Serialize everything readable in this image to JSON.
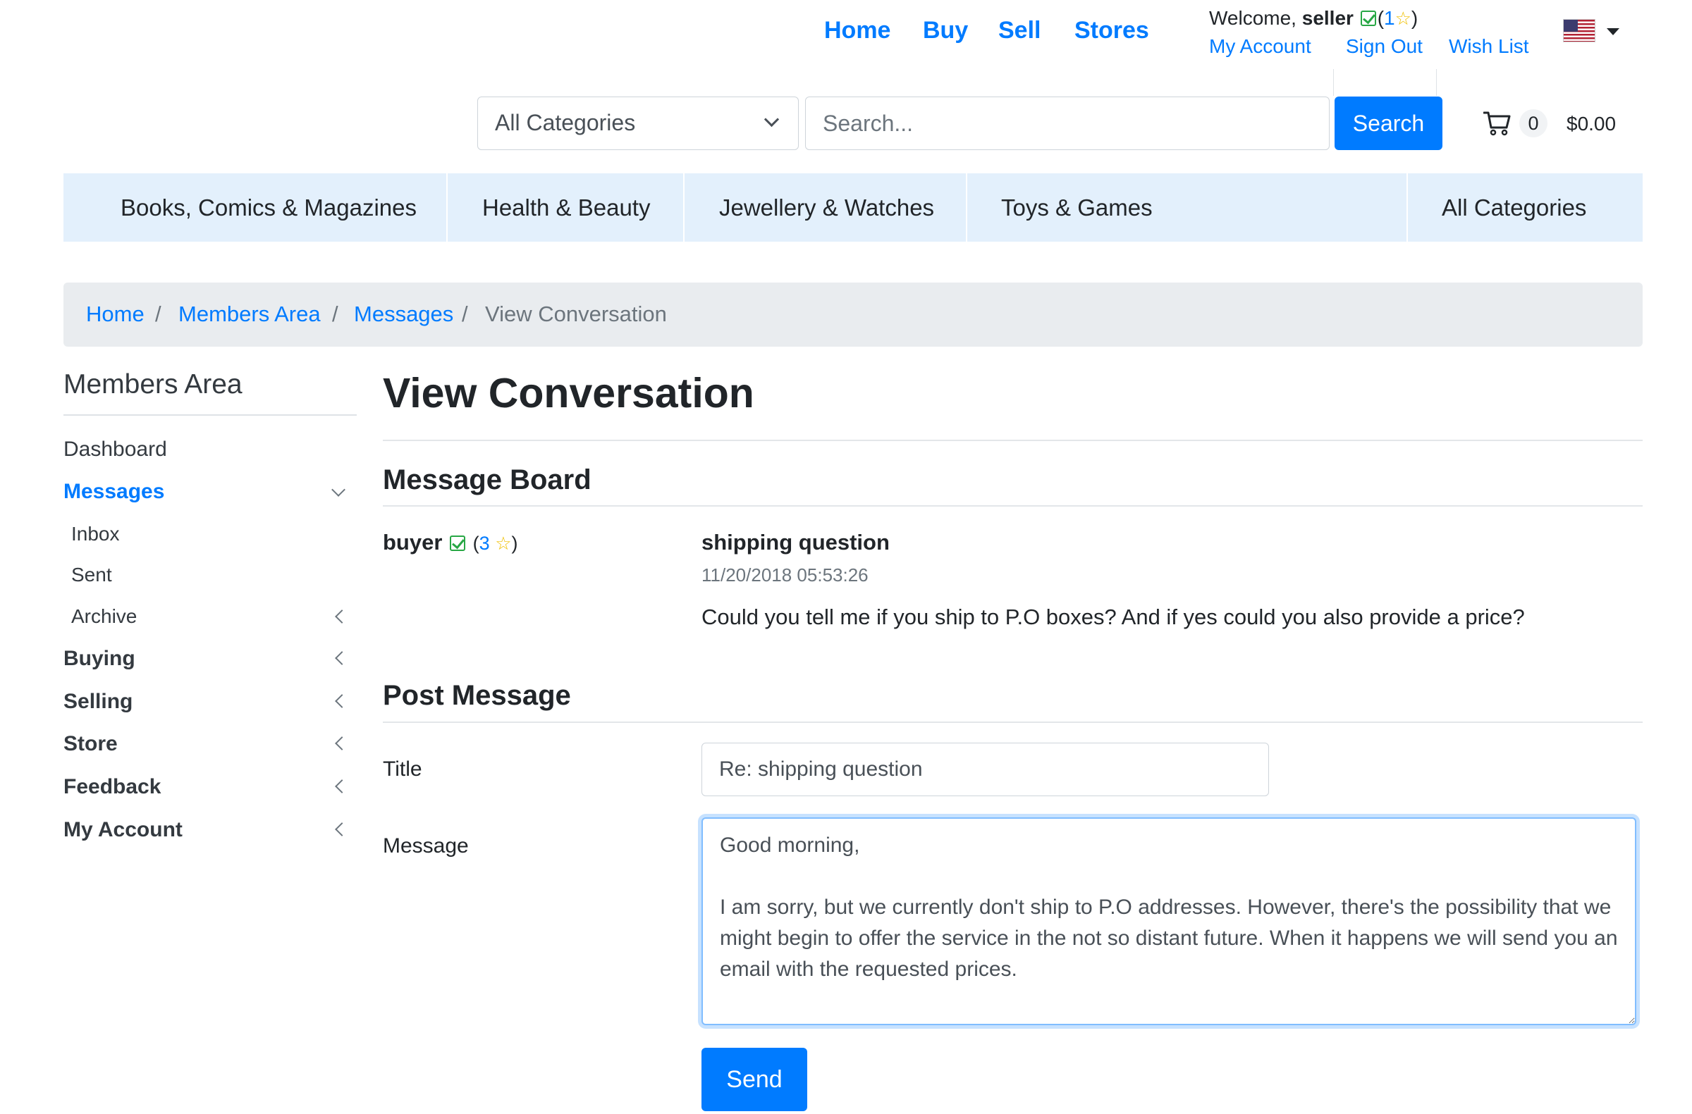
{
  "topnav": {
    "home": "Home",
    "buy": "Buy",
    "sell": "Sell",
    "stores": "Stores"
  },
  "user": {
    "welcome_prefix": "Welcome,",
    "username": "seller",
    "score_open": "(",
    "score": "1",
    "score_close": ")",
    "links": {
      "my_account": "My Account",
      "sign_out": "Sign Out",
      "wish_list": "Wish List"
    }
  },
  "language_icon": "us-flag-icon",
  "search": {
    "category_selected": "All Categories",
    "placeholder": "Search...",
    "button": "Search"
  },
  "cart": {
    "icon": "cart-icon",
    "count": "0",
    "total": "$0.00"
  },
  "categories": [
    "Books, Comics & Magazines",
    "Health & Beauty",
    "Jewellery & Watches",
    "Toys & Games",
    "All Categories"
  ],
  "breadcrumb": [
    "Home",
    "Members Area",
    "Messages",
    "View Conversation"
  ],
  "breadcrumb_sep": "/",
  "sidebar": {
    "title": "Members Area",
    "items": [
      {
        "label": "Dashboard"
      },
      {
        "label": "Messages"
      },
      {
        "label": "Inbox"
      },
      {
        "label": "Sent"
      },
      {
        "label": "Archive"
      },
      {
        "label": "Buying"
      },
      {
        "label": "Selling"
      },
      {
        "label": "Store"
      },
      {
        "label": "Feedback"
      },
      {
        "label": "My Account"
      }
    ]
  },
  "main": {
    "page_title": "View Conversation",
    "message_board_title": "Message Board",
    "message": {
      "sender": "buyer",
      "sender_score": "3",
      "subject": "shipping question",
      "date": "11/20/2018 05:53:26",
      "body": "Could you tell me if you ship to P.O boxes? And if yes could you also provide a price?"
    },
    "post_title": "Post Message",
    "form": {
      "title_label": "Title",
      "title_value": "Re: shipping question",
      "message_label": "Message",
      "message_value": "Good morning,\n\nI am sorry, but we currently don't ship to P.O addresses. However, there's the possibility that we might begin to offer the service in the not so distant future. When it happens we will send you an email with the requested prices.",
      "send": "Send"
    }
  },
  "colors": {
    "primary": "#007bff",
    "category_bar": "#e3f0fc",
    "breadcrumb_bg": "#e9ecef",
    "verified": "#28a745",
    "star": "#f0c000"
  }
}
